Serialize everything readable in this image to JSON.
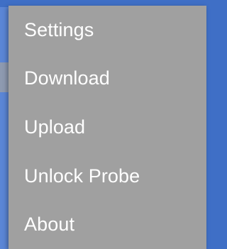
{
  "menu": {
    "items": [
      {
        "label": "Settings"
      },
      {
        "label": "Download"
      },
      {
        "label": "Upload"
      },
      {
        "label": "Unlock Probe"
      },
      {
        "label": "About"
      }
    ]
  },
  "colors": {
    "app_bar": "#3f6fc6",
    "menu_background": "#a0a0a0",
    "menu_text": "#ffffff"
  }
}
